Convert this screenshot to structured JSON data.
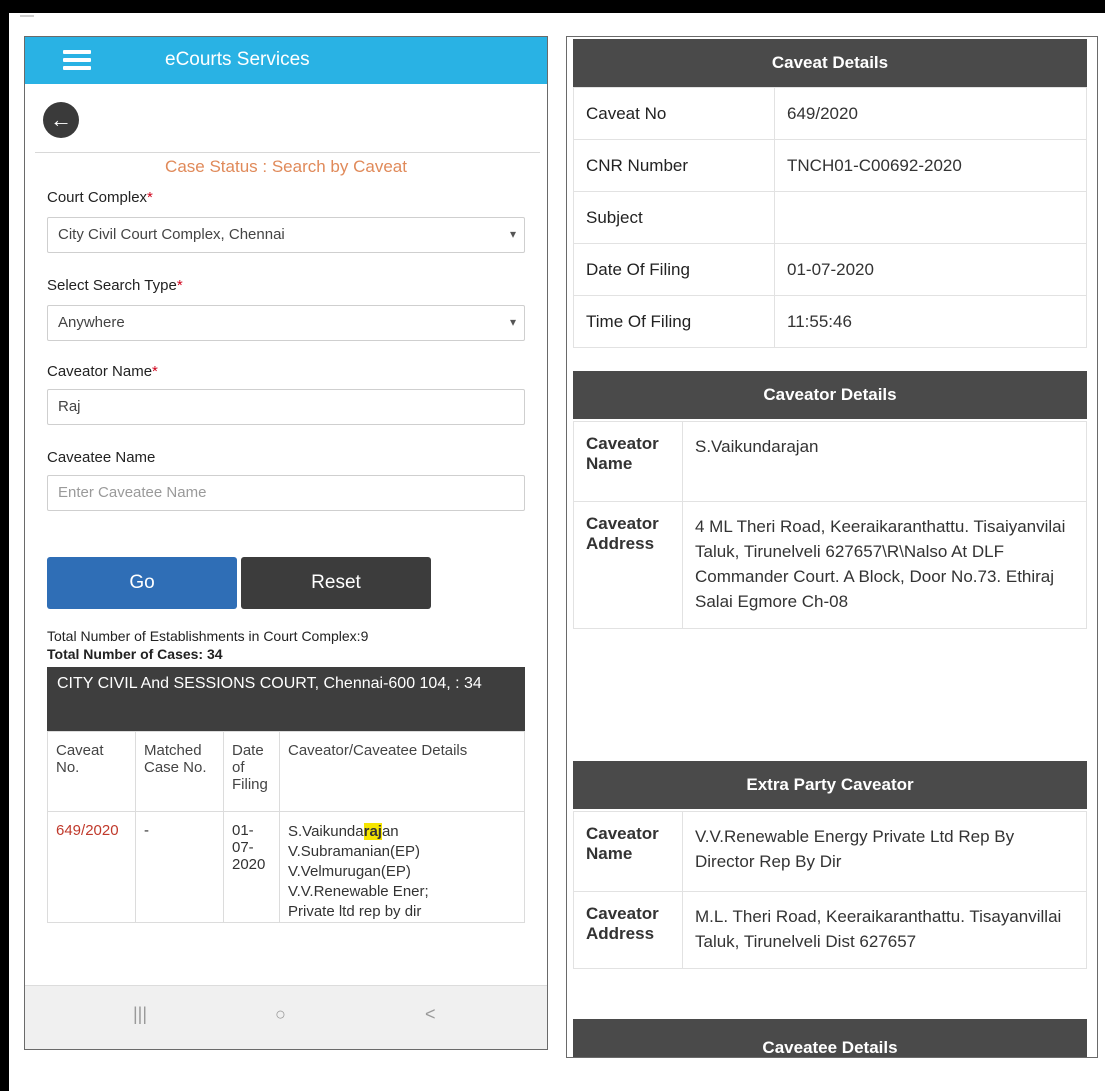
{
  "left_screen": {
    "appbar": {
      "title": "eCourts Services"
    },
    "search_title": "Case Status : Search by Caveat",
    "form": {
      "court_complex_label": "Court Complex",
      "court_complex_value": "City Civil Court Complex, Chennai",
      "search_type_label": "Select Search Type",
      "search_type_value": "Anywhere",
      "caveator_name_label": "Caveator Name",
      "caveator_name_value": "Raj",
      "caveatee_name_label": "Caveatee Name",
      "caveatee_name_placeholder": "Enter Caveatee Name",
      "required_mark": "*"
    },
    "buttons": {
      "go": "Go",
      "reset": "Reset"
    },
    "totals": {
      "establishments": "Total Number of Establishments in Court Complex:9",
      "cases": "Total Number of Cases: 34"
    },
    "establishment_header": "CITY CIVIL And SESSIONS COURT, Chennai-600 104, : 34",
    "table": {
      "headers": [
        "Caveat No.",
        "Matched Case No.",
        "Date of Filing",
        "Caveator/Caveatee Details"
      ],
      "row": {
        "caveat_no": "649/2020",
        "matched_case": "-",
        "date_lines": [
          "01-",
          "07-",
          "2020"
        ],
        "details_first_pre": "S.Vaikunda",
        "details_first_hl": "raj",
        "details_first_post": "an",
        "details_lines": [
          "V.Subramanian(EP)",
          "V.Velmurugan(EP)",
          "V.V.Renewable Ener;",
          "Private ltd rep by dir"
        ]
      }
    },
    "navbar": {
      "recent": "|||",
      "home": "○",
      "back": "<"
    }
  },
  "right_screen": {
    "caveat_details": {
      "title": "Caveat Details",
      "rows": [
        {
          "key": "Caveat No",
          "value": "649/2020"
        },
        {
          "key": "CNR Number",
          "value": "TNCH01-C00692-2020"
        },
        {
          "key": "Subject",
          "value": ""
        },
        {
          "key": "Date Of Filing",
          "value": "01-07-2020"
        },
        {
          "key": "Time Of Filing",
          "value": "11:55:46"
        }
      ]
    },
    "caveator_details": {
      "title": "Caveator Details",
      "name_key": "Caveator Name",
      "name_value": "S.Vaikundarajan",
      "address_key": "Caveator Address",
      "address_value": "4 ML Theri Road, Keeraikaranthattu. Tisaiyanvilai Taluk, Tirunelveli 627657\\R\\Nalso At DLF Commander Court. A Block, Door No.73. Ethiraj Salai Egmore Ch-08"
    },
    "extra_party": {
      "title": "Extra Party Caveator",
      "name_key": "Caveator Name",
      "name_value": "V.V.Renewable Energy Private Ltd Rep By Director Rep By Dir",
      "address_key": "Caveator Address",
      "address_value": "M.L. Theri Road, Keeraikaranthattu. Tisayanvillai Taluk, Tirunelveli Dist 627657"
    },
    "caveatee_details": {
      "title": "Caveatee Details"
    }
  },
  "colors": {
    "appbar": "#29b2e4",
    "go_button": "#2f6eb6",
    "reset_button": "#3c3c3c",
    "section_header": "#4a4a4a",
    "caveat_link": "#c0392b",
    "highlight": "#f6e500",
    "search_title": "#e08a5a"
  }
}
